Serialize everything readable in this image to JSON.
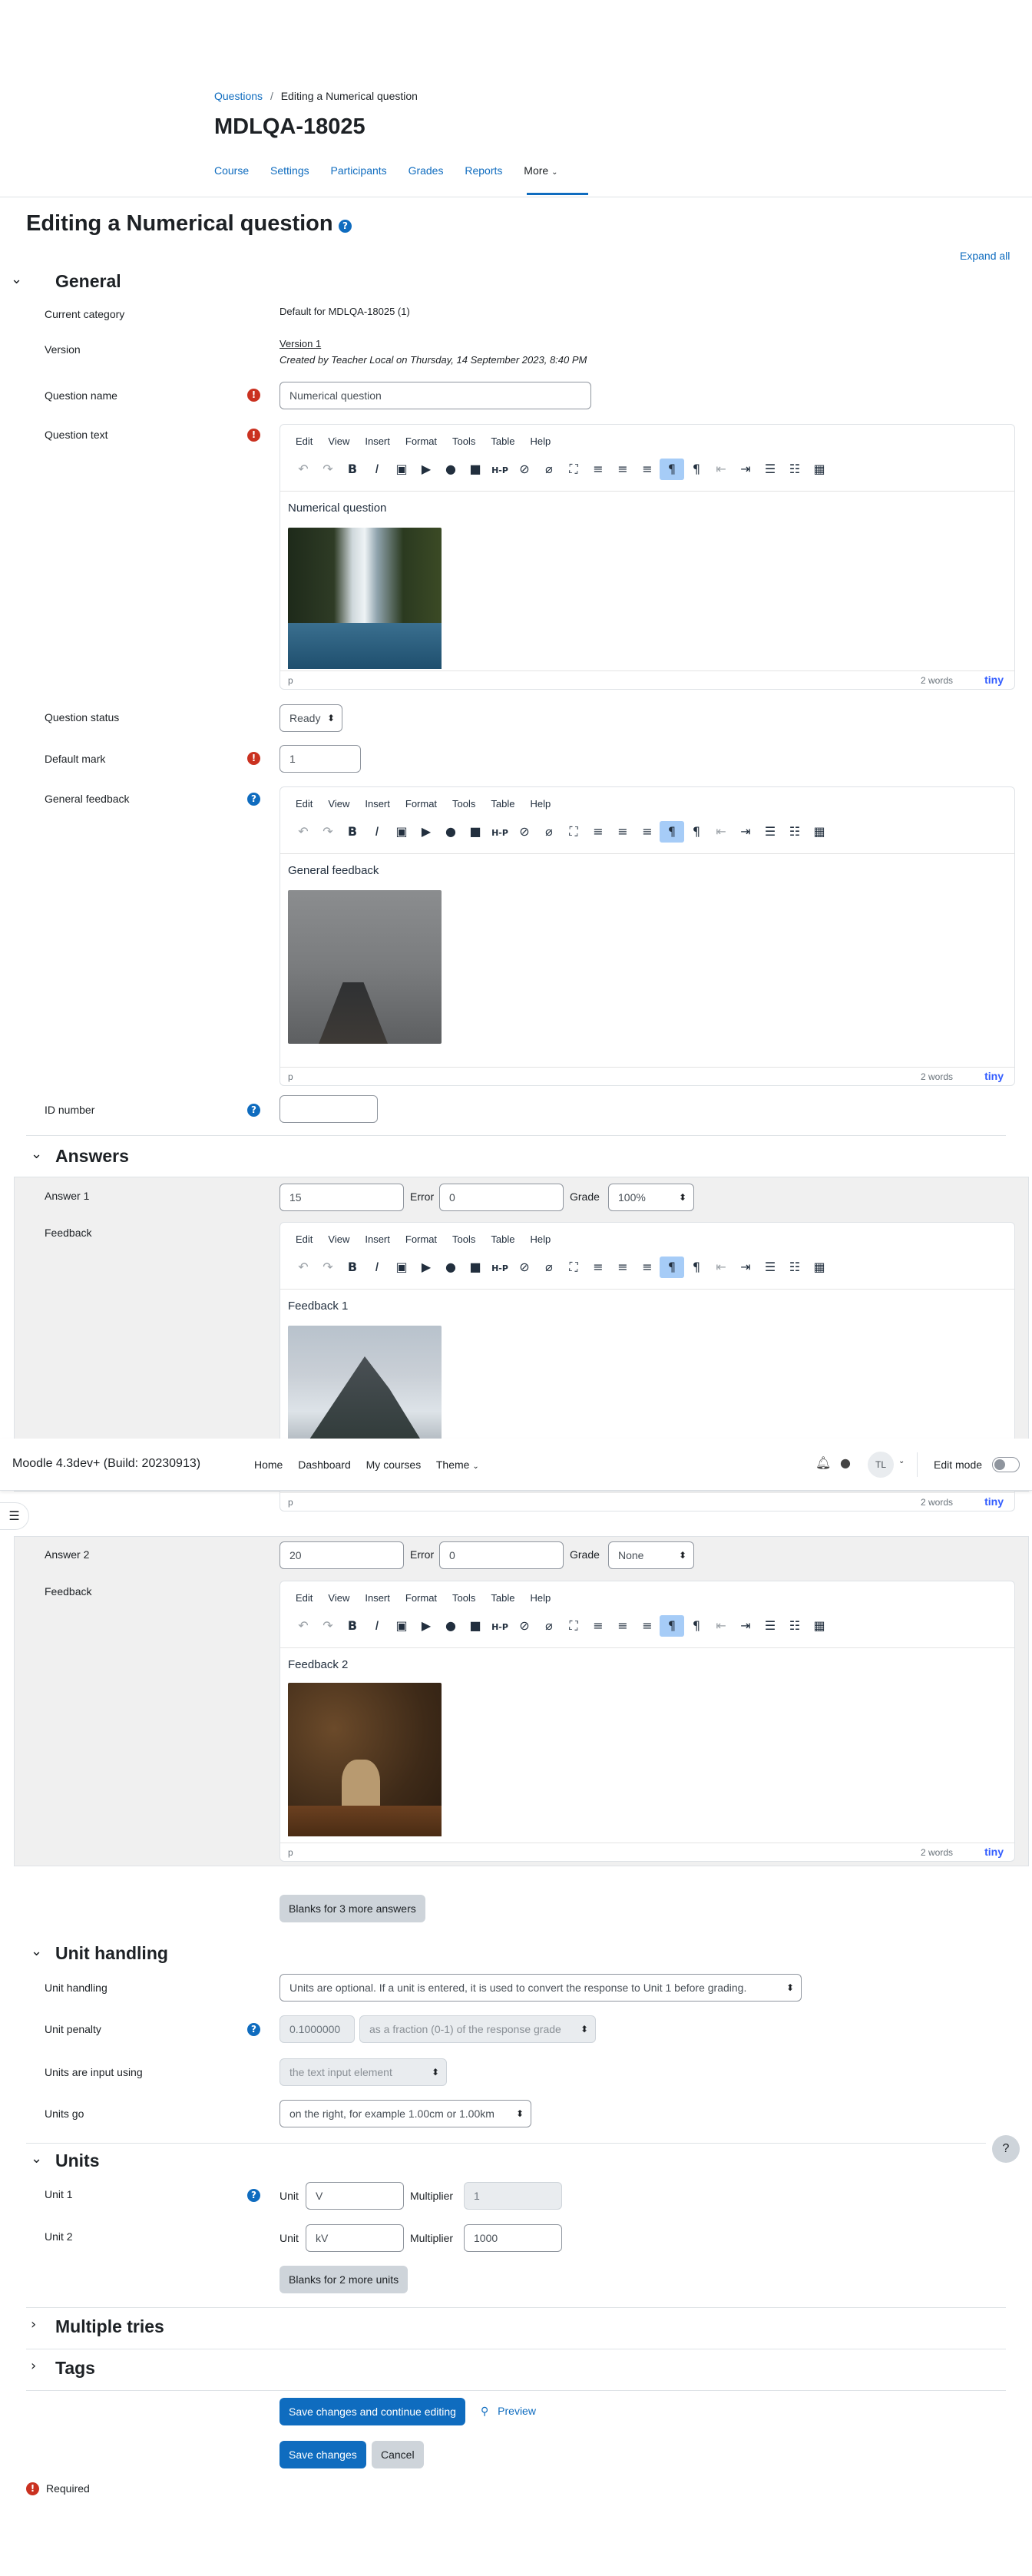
{
  "breadcrumb": {
    "root": "Questions",
    "sep": "/",
    "current": "Editing a Numerical question"
  },
  "course": {
    "title": "MDLQA-18025"
  },
  "nav": {
    "course": "Course",
    "settings": "Settings",
    "participants": "Participants",
    "grades": "Grades",
    "reports": "Reports",
    "more": "More"
  },
  "page": {
    "title": "Editing a Numerical question",
    "expand_all": "Expand all"
  },
  "general": {
    "heading": "General",
    "category_label": "Current category",
    "category_value": "Default for MDLQA-18025 (1)",
    "version_label": "Version",
    "version_value": "Version 1",
    "version_created": "Created by Teacher Local on Thursday, 14 September 2023, 8:40 PM",
    "name_label": "Question name",
    "name_value": "Numerical question",
    "text_label": "Question text",
    "text_content": "Numerical question",
    "status_label": "Question status",
    "status_value": "Ready",
    "mark_label": "Default mark",
    "mark_value": "1",
    "feedback_label": "General feedback",
    "feedback_content": "General feedback",
    "idnumber_label": "ID number",
    "idnumber_value": ""
  },
  "editor": {
    "menu": [
      "Edit",
      "View",
      "Insert",
      "Format",
      "Tools",
      "Table",
      "Help"
    ],
    "status_p": "p",
    "words": "2 words",
    "brand": "tiny"
  },
  "answers": {
    "heading": "Answers",
    "error_label": "Error",
    "grade_label": "Grade",
    "feedback_label": "Feedback",
    "items": [
      {
        "label": "Answer 1",
        "value": "15",
        "error": "0",
        "grade": "100%",
        "feedback": "Feedback 1"
      },
      {
        "label": "Answer 2",
        "value": "20",
        "error": "0",
        "grade": "None",
        "feedback": "Feedback 2"
      }
    ],
    "blanks_button": "Blanks for 3 more answers"
  },
  "navbar": {
    "site": "Moodle 4.3dev+ (Build: 20230913)",
    "home": "Home",
    "dashboard": "Dashboard",
    "my_courses": "My courses",
    "theme": "Theme",
    "avatar": "TL",
    "edit_mode": "Edit mode"
  },
  "unit_handling": {
    "heading": "Unit handling",
    "handling_label": "Unit handling",
    "handling_value": "Units are optional. If a unit is entered, it is used to convert the response to Unit 1 before grading.",
    "penalty_label": "Unit penalty",
    "penalty_value": "0.1000000",
    "penalty_mode": "as a fraction (0-1) of the response grade",
    "input_label": "Units are input using",
    "input_value": "the text input element",
    "go_label": "Units go",
    "go_value": "on the right, for example 1.00cm or 1.00km"
  },
  "units": {
    "heading": "Units",
    "unit_label": "Unit",
    "multiplier_label": "Multiplier",
    "items": [
      {
        "label": "Unit 1",
        "unit": "V",
        "multiplier": "1"
      },
      {
        "label": "Unit 2",
        "unit": "kV",
        "multiplier": "1000"
      }
    ],
    "blanks_button": "Blanks for 2 more units"
  },
  "multiple_tries": {
    "heading": "Multiple tries"
  },
  "tags": {
    "heading": "Tags"
  },
  "actions": {
    "save_continue": "Save changes and continue editing",
    "preview": "Preview",
    "save": "Save changes",
    "cancel": "Cancel"
  },
  "required_note": "Required",
  "help_button": "?",
  "colors": {
    "primary": "#0f6cbf",
    "required": "#ca3120",
    "section_bg": "#f0f0f0"
  }
}
